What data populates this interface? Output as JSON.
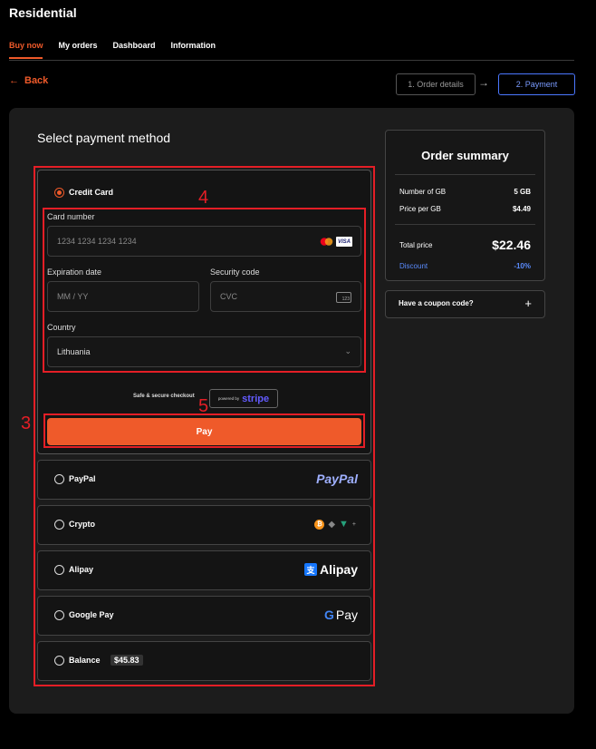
{
  "header": {
    "title": "Residential"
  },
  "nav": {
    "tabs": [
      {
        "label": "Buy now"
      },
      {
        "label": "My orders"
      },
      {
        "label": "Dashboard"
      },
      {
        "label": "Information"
      }
    ]
  },
  "back_label": "Back",
  "steps": {
    "step1": "1. Order details",
    "step2": "2. Payment"
  },
  "payment": {
    "heading": "Select payment method",
    "credit_card": {
      "label": "Credit Card",
      "card_number_label": "Card number",
      "card_number_placeholder": "1234 1234 1234 1234",
      "visa": "VISA",
      "expiration_label": "Expiration date",
      "expiration_placeholder": "MM / YY",
      "security_label": "Security code",
      "security_placeholder": "CVC",
      "cvc_icon_text": "123",
      "country_label": "Country",
      "country_value": "Lithuania",
      "secure_text": "Safe & secure checkout",
      "stripe_powered": "powered by",
      "stripe_name": "stripe",
      "pay_label": "Pay"
    },
    "methods": [
      {
        "label": "PayPal",
        "brand": "PayPal"
      },
      {
        "label": "Crypto"
      },
      {
        "label": "Alipay",
        "brand": "Alipay"
      },
      {
        "label": "Google Pay",
        "brand": "Pay"
      },
      {
        "label": "Balance",
        "badge": "$45.83"
      }
    ]
  },
  "summary": {
    "title": "Order summary",
    "rows": [
      {
        "label": "Number of GB",
        "value": "5 GB"
      },
      {
        "label": "Price per GB",
        "value": "$4.49"
      }
    ],
    "total_label": "Total price",
    "total_value": "$22.46",
    "discount_label": "Discount",
    "discount_value": "-10%"
  },
  "coupon": {
    "label": "Have a coupon code?"
  },
  "annotations": {
    "a3": "3",
    "a4": "4",
    "a5": "5"
  },
  "colors": {
    "accent": "#ef5a2a",
    "annotation": "#e41e26",
    "discount": "#5b8cff"
  }
}
